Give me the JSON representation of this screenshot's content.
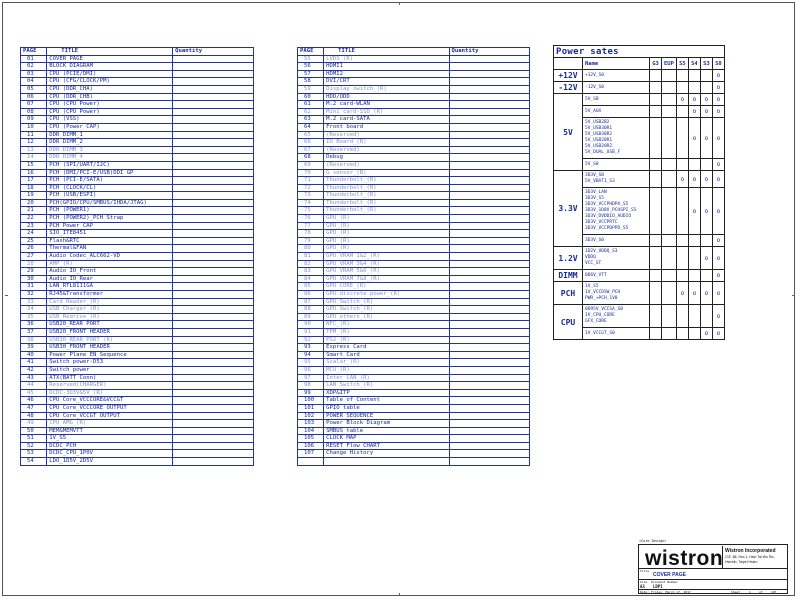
{
  "index_header": {
    "page": "PAGE",
    "title": "TITLE",
    "quantity": "Quantity"
  },
  "left_index": [
    {
      "p": "01",
      "t": "COVER PAGE"
    },
    {
      "p": "02",
      "t": "BLOCK DIAGRAM"
    },
    {
      "p": "03",
      "t": "CPU (PCIE/DMI)"
    },
    {
      "p": "04",
      "t": "CPU (CFG/CLOCK/PM)"
    },
    {
      "p": "05",
      "t": "CPU (DDR_CHA)"
    },
    {
      "p": "06",
      "t": "CPU (DDR_CHB)"
    },
    {
      "p": "07",
      "t": "CPU (CPU Power)"
    },
    {
      "p": "08",
      "t": "CPU (CPU Power)"
    },
    {
      "p": "09",
      "t": "CPU (VSS)"
    },
    {
      "p": "10",
      "t": "CPU (Power CAP)"
    },
    {
      "p": "11",
      "t": "DDR DIMM_1"
    },
    {
      "p": "12",
      "t": "DDR DIMM_2"
    },
    {
      "p": "13",
      "t": "DDR DIMM_3",
      "pale": true
    },
    {
      "p": "14",
      "t": "DDR DIMM_4",
      "pale": true
    },
    {
      "p": "15",
      "t": "PCH (SPI/UART/I2C)"
    },
    {
      "p": "16",
      "t": "PCH (DMI/PCI-E/USB)DDI GP"
    },
    {
      "p": "17",
      "t": "PCH (PCI-E/SATA)"
    },
    {
      "p": "18",
      "t": "PCH (CLOCK/CL)"
    },
    {
      "p": "19",
      "t": "PCH (USB/ESPI)"
    },
    {
      "p": "20",
      "t": "PCH(GPIO/CPU/SMBUS/IHDA/JTAG)"
    },
    {
      "p": "21",
      "t": "PCH (POWER1)"
    },
    {
      "p": "22",
      "t": "PCH (POWER2)_PCH Strap"
    },
    {
      "p": "23",
      "t": "PCH Power CAP"
    },
    {
      "p": "24",
      "t": "SIO_ITE8451"
    },
    {
      "p": "25",
      "t": "Flash&RTC"
    },
    {
      "p": "26",
      "t": "Thermal&FAN"
    },
    {
      "p": "27",
      "t": "Audio Codec_ALC662-VD"
    },
    {
      "p": "28",
      "t": "AMP_(R)",
      "pale": true
    },
    {
      "p": "29",
      "t": "Audio IO_Front"
    },
    {
      "p": "30",
      "t": "Audio IO_Rear"
    },
    {
      "p": "31",
      "t": "LAN_RTL8111GA"
    },
    {
      "p": "32",
      "t": "RJ45&Transformer"
    },
    {
      "p": "33",
      "t": "Card Reader_(R)",
      "pale": true
    },
    {
      "p": "34",
      "t": "USB Charger_(R)",
      "pale": true
    },
    {
      "p": "35",
      "t": "USB_Redrive_(R)",
      "pale": true
    },
    {
      "p": "36",
      "t": "USB20_REAR PORT"
    },
    {
      "p": "37",
      "t": "USB20_FRONT HEADER"
    },
    {
      "p": "38",
      "t": "USB30_REAR PORT (R)",
      "pale": true
    },
    {
      "p": "39",
      "t": "USB30_FRONT HEADER"
    },
    {
      "p": "40",
      "t": "Power Plane EN Sequence"
    },
    {
      "p": "41",
      "t": "Switch power-D53"
    },
    {
      "p": "42",
      "t": "Switch power"
    },
    {
      "p": "43",
      "t": "ATX(BATT Conn)"
    },
    {
      "p": "44",
      "t": "Reserved(CHARGER)",
      "pale": true
    },
    {
      "p": "45",
      "t": "DCDC-3D3V&5V_(R)",
      "pale": true
    },
    {
      "p": "46",
      "t": "CPU Core_VCCCORE&VCCGT"
    },
    {
      "p": "47",
      "t": "CPU Core_VCCCORE OUTPUT"
    },
    {
      "p": "48",
      "t": "CPU Core_VCCGT OUTPUT"
    },
    {
      "p": "49",
      "t": "CPU AMG_(R)",
      "pale": true
    },
    {
      "p": "50",
      "t": "MEM&MEMVTT"
    },
    {
      "p": "51",
      "t": "1V_S5"
    },
    {
      "p": "52",
      "t": "DCDC_PCH"
    },
    {
      "p": "53",
      "t": "DCDC_CPU_1P0V"
    },
    {
      "p": "54",
      "t": "LDO_1D5V_2D5V"
    }
  ],
  "mid_index": [
    {
      "p": "55",
      "t": "LVDS_(R)",
      "pale": true
    },
    {
      "p": "56",
      "t": "HDMI1"
    },
    {
      "p": "57",
      "t": "HDMI2"
    },
    {
      "p": "58",
      "t": "DVI/CRT"
    },
    {
      "p": "59",
      "t": "Display switch_(R)",
      "pale": true
    },
    {
      "p": "60",
      "t": "HDD/ODD"
    },
    {
      "p": "61",
      "t": "M.2 card-WLAN"
    },
    {
      "p": "62",
      "t": "Mini card-SSD_(R)",
      "pale": true
    },
    {
      "p": "63",
      "t": "M.2 card-SATA"
    },
    {
      "p": "64",
      "t": "Front board"
    },
    {
      "p": "65",
      "t": "(Reserved)",
      "pale": true
    },
    {
      "p": "66",
      "t": "IO Board_(R)",
      "pale": true
    },
    {
      "p": "67",
      "t": "(Reserved)",
      "pale": true
    },
    {
      "p": "68",
      "t": "Debug"
    },
    {
      "p": "69",
      "t": "(Reserved)",
      "pale": true
    },
    {
      "p": "70",
      "t": "G sensor_(R)",
      "pale": true
    },
    {
      "p": "71",
      "t": "Thunderbolt_(R)",
      "pale": true
    },
    {
      "p": "72",
      "t": "Thunderbolt_(R)",
      "pale": true
    },
    {
      "p": "73",
      "t": "Thunderbolt_(R)",
      "pale": true
    },
    {
      "p": "74",
      "t": "Thunderbolt_(R)",
      "pale": true
    },
    {
      "p": "75",
      "t": "Thunderbolt_(R)",
      "pale": true
    },
    {
      "p": "76",
      "t": "GPU_(R)",
      "pale": true
    },
    {
      "p": "77",
      "t": "GPU_(R)",
      "pale": true
    },
    {
      "p": "78",
      "t": "GPU_(R)",
      "pale": true
    },
    {
      "p": "79",
      "t": "GPU_(R)",
      "pale": true
    },
    {
      "p": "80",
      "t": "GPU_(R)",
      "pale": true
    },
    {
      "p": "81",
      "t": "GPU VRAM 1&2_(R)",
      "pale": true
    },
    {
      "p": "82",
      "t": "GPU VRAM 3&4_(R)",
      "pale": true
    },
    {
      "p": "83",
      "t": "GPU VRAM 5&6_(R)",
      "pale": true
    },
    {
      "p": "84",
      "t": "GPU VRAM 7&8_(R)",
      "pale": true
    },
    {
      "p": "85",
      "t": "GPU CORE_(R)",
      "pale": true
    },
    {
      "p": "86",
      "t": "GPU discrete power_(R)",
      "pale": true
    },
    {
      "p": "87",
      "t": "GPU Switch_(R)",
      "pale": true
    },
    {
      "p": "88",
      "t": "GPU Switch_(R)",
      "pale": true
    },
    {
      "p": "89",
      "t": "GPU others_(R)",
      "pale": true
    },
    {
      "p": "90",
      "t": "NFC_(R)",
      "pale": true
    },
    {
      "p": "91",
      "t": "TPM_(R)",
      "pale": true
    },
    {
      "p": "92",
      "t": "PS2_(R)",
      "pale": true
    },
    {
      "p": "93",
      "t": "Express Card"
    },
    {
      "p": "94",
      "t": "Smart Card"
    },
    {
      "p": "95",
      "t": "Scalar_(R)",
      "pale": true
    },
    {
      "p": "96",
      "t": "MCU_(R)",
      "pale": true
    },
    {
      "p": "97",
      "t": "Inter LAN_(R)",
      "pale": true
    },
    {
      "p": "98",
      "t": "LAN Switch_(R)",
      "pale": true
    },
    {
      "p": "99",
      "t": "XDP&ITP"
    },
    {
      "p": "100",
      "t": "Table of Content"
    },
    {
      "p": "101",
      "t": "GPIO table"
    },
    {
      "p": "102",
      "t": "POWER SEQUENCE"
    },
    {
      "p": "103",
      "t": "Power Block Diagram"
    },
    {
      "p": "104",
      "t": "SMBUS table"
    },
    {
      "p": "105",
      "t": "CLOCK MAP"
    },
    {
      "p": "106",
      "t": "RESET Flow CHART"
    },
    {
      "p": "107",
      "t": "Change History"
    }
  ],
  "power_states": {
    "title": "Power sates",
    "headers": [
      "Name",
      "G3",
      "EUP",
      "S5",
      "S4",
      "S3",
      "S0"
    ],
    "mark": "o",
    "groups": [
      {
        "label": "+12V",
        "rows": [
          {
            "names": [
              "+12V_S0"
            ],
            "marks": [
              0,
              0,
              0,
              0,
              0,
              1
            ]
          }
        ]
      },
      {
        "label": "-12V",
        "rows": [
          {
            "names": [
              "-12V_S0"
            ],
            "marks": [
              0,
              0,
              0,
              0,
              0,
              1
            ]
          }
        ]
      },
      {
        "label": "5V",
        "rows": [
          {
            "names": [
              "5V_SB"
            ],
            "marks": [
              0,
              0,
              1,
              1,
              1,
              1
            ]
          },
          {
            "names": [
              "5V_AUX"
            ],
            "marks": [
              0,
              0,
              0,
              1,
              1,
              1
            ]
          },
          {
            "names": [
              "5V_USB2B2",
              "5V_USB30R1",
              "5V_USB30R2",
              "5V_USB20R1",
              "5V_USB20R2",
              "5V_DUAL_USB_F"
            ],
            "marks": [
              0,
              0,
              0,
              1,
              1,
              1
            ]
          },
          {
            "names": [
              "5V_S0"
            ],
            "marks": [
              0,
              0,
              0,
              0,
              0,
              1
            ]
          }
        ]
      },
      {
        "label": "3.3V",
        "rows": [
          {
            "names": [
              "3D3V_SB",
              "5V_VBAT1_S3"
            ],
            "marks": [
              0,
              0,
              1,
              1,
              1,
              1
            ]
          },
          {
            "names": [
              "3D3V_LAN",
              "3D3V_S5",
              "3D3V_VCCPHDPA_S5",
              "3D3V_1D8V_PCHSPI_S5",
              "3D3V_DVDDIO_AUDIO",
              "3D3V_VCCPRTC",
              "3D3V_VCCPDPPD_S5"
            ],
            "marks": [
              0,
              0,
              0,
              1,
              1,
              1
            ]
          },
          {
            "names": [
              "3D3V_S0"
            ],
            "marks": [
              0,
              0,
              0,
              0,
              0,
              1
            ]
          }
        ]
      },
      {
        "label": "1.2V",
        "rows": [
          {
            "names": [
              "1D2V_VDDQ_S3",
              "VDDQ",
              "VCC_ST"
            ],
            "marks": [
              0,
              0,
              0,
              0,
              1,
              1
            ]
          }
        ]
      },
      {
        "label": "DIMM",
        "rows": [
          {
            "names": [
              "0D6V_VTT"
            ],
            "marks": [
              0,
              0,
              0,
              0,
              0,
              1
            ]
          }
        ]
      },
      {
        "label": "PCH",
        "rows": [
          {
            "names": [
              "1V_S5",
              "1V_VCCDSW_PCH",
              "PWR_+PCH_1V0"
            ],
            "marks": [
              0,
              0,
              1,
              1,
              1,
              1
            ]
          }
        ]
      },
      {
        "label": "CPU",
        "rows": [
          {
            "names": [
              "0D95V_VCCSA_S0",
              "1V_CPU_CORE",
              "GFX_CORE"
            ],
            "marks": [
              0,
              0,
              0,
              0,
              0,
              1
            ]
          },
          {
            "names": [
              "1V_VCCGT_S0"
            ],
            "marks": [
              0,
              0,
              0,
              0,
              1,
              1
            ]
          }
        ]
      }
    ]
  },
  "title_block": {
    "design": "<Core Design>",
    "logo": "wistron",
    "company": "Wistron Incorporated",
    "address1": "21F, 88, Sec.1, Hsin Tai Wu Rd.,",
    "address2": "Hsichih, Taipei Hsien",
    "title_label": "Title",
    "title": "COVER PAGE",
    "size_label": "Size",
    "doc_label": "Document Number",
    "size": "A3",
    "doc": "LDP1",
    "date_label": "Date:",
    "date": "Friday, March 17, 2017",
    "sheet_label": "Sheet",
    "sheet": "1",
    "of": "of",
    "total": "107"
  }
}
